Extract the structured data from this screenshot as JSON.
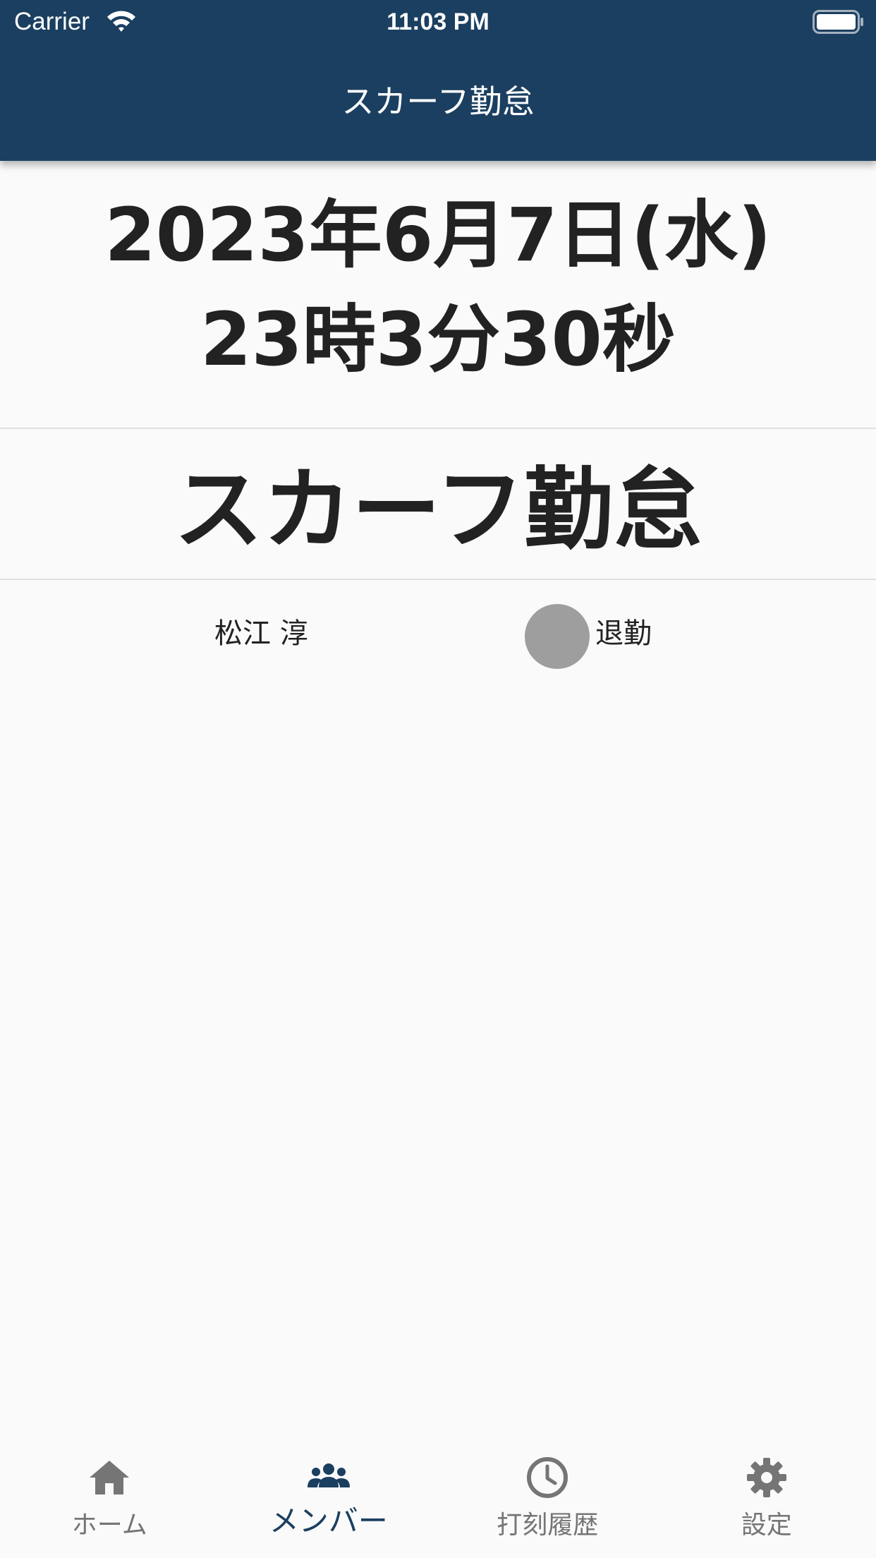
{
  "status_bar": {
    "carrier": "Carrier",
    "time": "11:03 PM"
  },
  "app_bar": {
    "title": "スカーフ勤怠"
  },
  "clock": {
    "date": "2023年6月7日(水)",
    "time": "23時3分30秒"
  },
  "main_title": "スカーフ勤怠",
  "members": [
    {
      "name": "松江 淳",
      "status": "退勤",
      "status_color": "#9e9e9e"
    }
  ],
  "bottom_nav": {
    "items": [
      {
        "label": "ホーム",
        "icon": "home-icon",
        "active": false
      },
      {
        "label": "メンバー",
        "icon": "users-icon",
        "active": true
      },
      {
        "label": "打刻履歴",
        "icon": "clock-icon",
        "active": false
      },
      {
        "label": "設定",
        "icon": "gear-icon",
        "active": false
      }
    ]
  },
  "colors": {
    "primary": "#1b3f60",
    "inactive": "#757575",
    "background": "#fafafa",
    "text": "#222222"
  }
}
